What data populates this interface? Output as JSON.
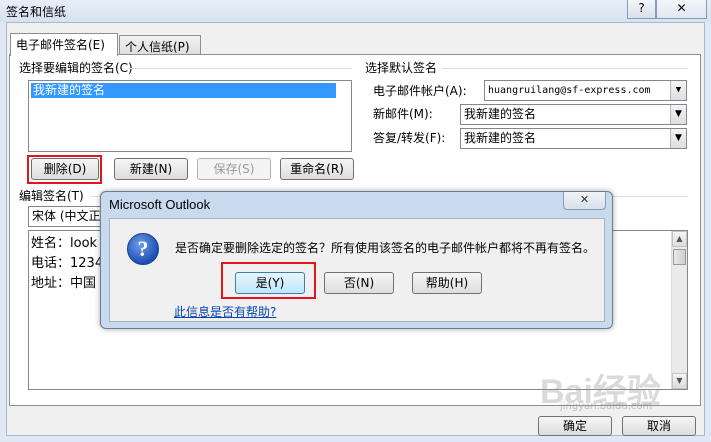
{
  "window": {
    "title": "签名和信纸",
    "help_glyph": "?",
    "close_glyph": "✕"
  },
  "tabs": [
    {
      "label": "电子邮件签名(E)"
    },
    {
      "label": "个人信纸(P)"
    }
  ],
  "select_signature": {
    "label": "选择要编辑的签名(C)",
    "items": [
      "我新建的签名"
    ],
    "buttons": {
      "delete": "删除(D)",
      "new": "新建(N)",
      "save": "保存(S)",
      "rename": "重命名(R)"
    }
  },
  "default_signature": {
    "label": "选择默认签名",
    "account_label": "电子邮件帐户(A):",
    "account_value": "huangruilang@sf-express.com",
    "new_message_label": "新邮件(M):",
    "new_message_value": "我新建的签名",
    "reply_forward_label": "答复/转发(F):",
    "reply_forward_value": "我新建的签名"
  },
  "edit_signature": {
    "label": "编辑签名(T)",
    "font": "宋体 (中文正",
    "lines": [
      "姓名：look",
      "电话：1234",
      "地址：中国"
    ]
  },
  "footer": {
    "ok": "确定",
    "cancel": "取消"
  },
  "dialog": {
    "title": "Microsoft Outlook",
    "close_glyph": "✕",
    "message": "是否确定要删除选定的签名？所有使用该签名的电子邮件帐户都将不再有签名。",
    "buttons": {
      "yes": "是(Y)",
      "no": "否(N)",
      "help": "帮助(H)"
    },
    "help_link": "此信息是否有帮助?"
  },
  "watermark": {
    "text": "Bai经验",
    "sub": "jingyan.baidu.com"
  },
  "colors": {
    "highlight": "#3399ff",
    "red_annotation": "#e3151a",
    "link": "#0645ad"
  }
}
